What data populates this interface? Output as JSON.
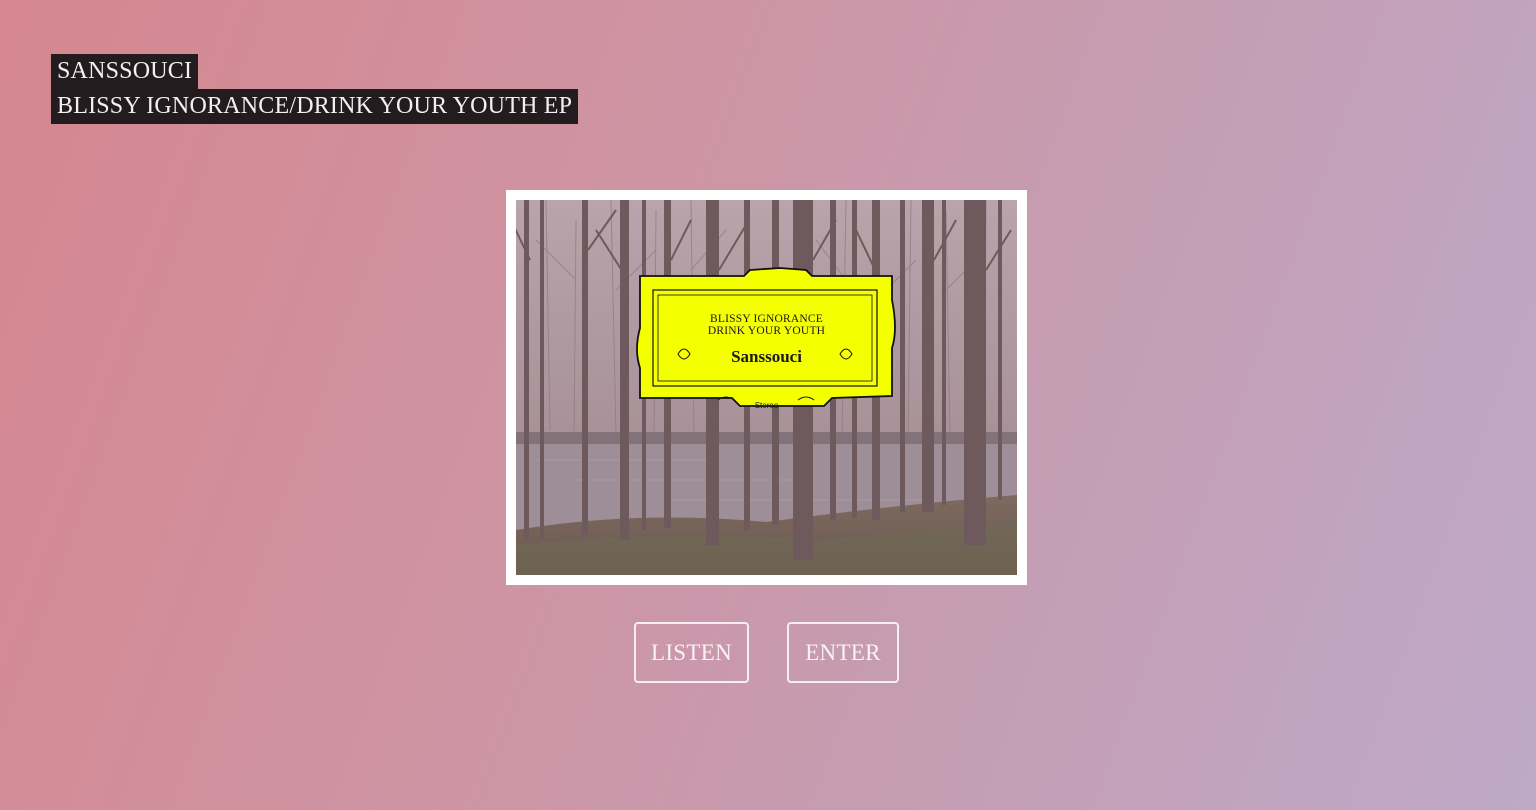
{
  "header": {
    "artist": "SANSSOUCI",
    "release": "BLISSY IGNORANCE/DRINK YOUR YOUTH EP"
  },
  "cover": {
    "label_title_line1": "BLISSY IGNORANCE",
    "label_title_line2": "DRINK YOUR YOUTH",
    "label_artist": "Sanssouci",
    "label_stereo": "Stereo",
    "label_color": "#f5ff00"
  },
  "actions": {
    "listen_label": "LISTEN",
    "enter_label": "ENTER"
  },
  "colors": {
    "background_start": "#d5868f",
    "background_end": "#bea9c8",
    "title_bg": "#221c1e"
  }
}
